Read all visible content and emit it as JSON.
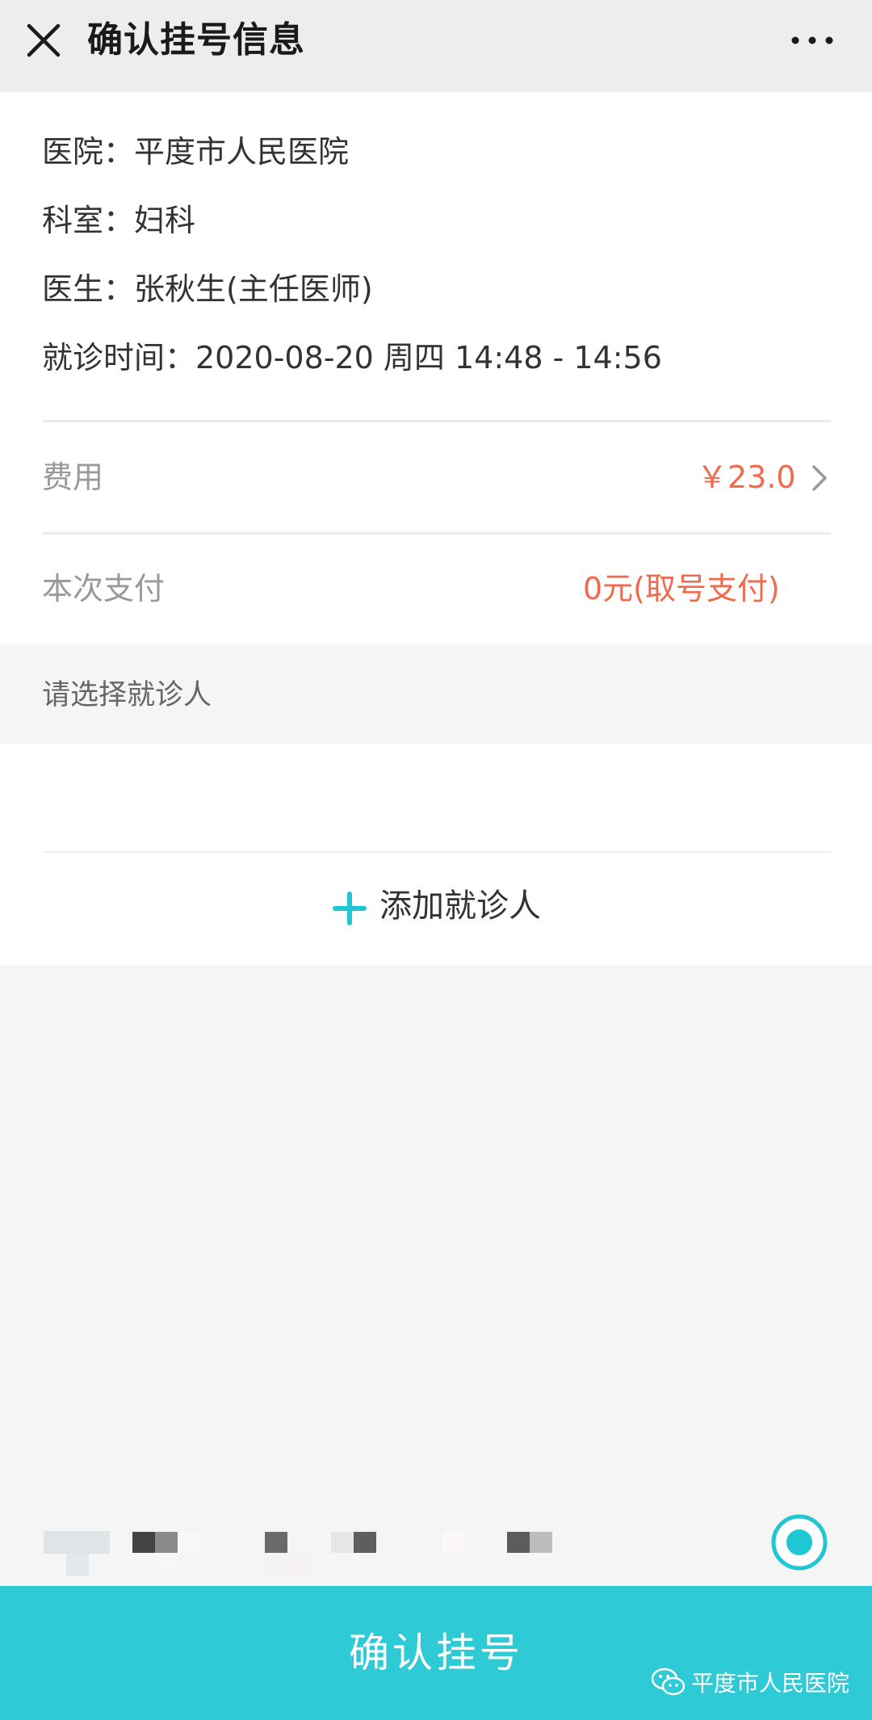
{
  "header": {
    "title": "确认挂号信息",
    "close_icon": "close-icon",
    "more_icon": "more-dots-icon"
  },
  "info": {
    "hospital": "医院：平度市人民医院",
    "department": "科室：妇科",
    "doctor": "医生：张秋生(主任医师)",
    "visit_time": "就诊时间：2020-08-20 周四 14:48 - 14:56"
  },
  "fee": {
    "label": "费用",
    "value": "￥23.0"
  },
  "payment": {
    "label": "本次支付",
    "value": "0元(取号支付)"
  },
  "patients": {
    "section_title": "请选择就诊人",
    "selected": true,
    "add_label": "添加就诊人"
  },
  "footer": {
    "confirm_label": "确认挂号",
    "watermark": "平度市人民医院"
  },
  "colors": {
    "accent": "#2ecad6",
    "price": "#f06a4e",
    "header_bg": "#ededed",
    "page_bg": "#f5f5f5"
  }
}
